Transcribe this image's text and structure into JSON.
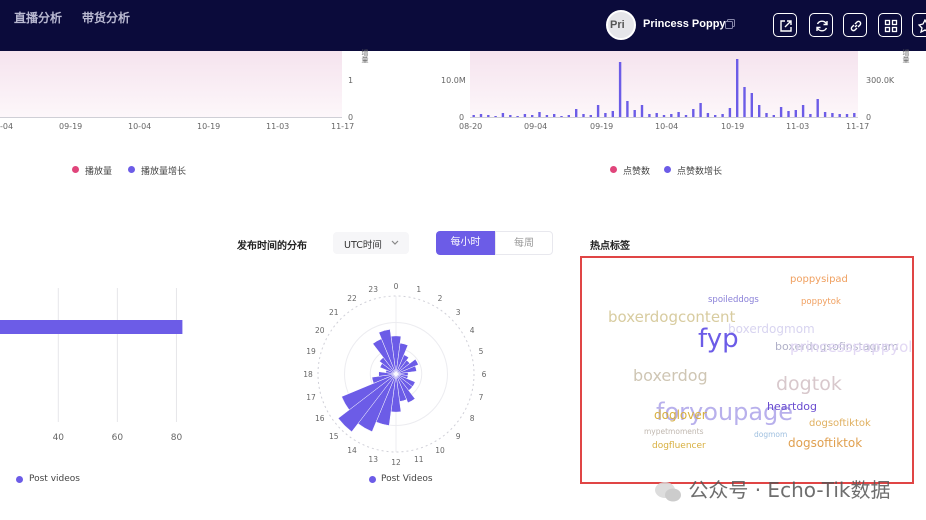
{
  "nav": {
    "tab_live": "直播分析",
    "tab_goods": "带货分析"
  },
  "profile": {
    "avatar_text": "Pri",
    "name": "Princess Poppy"
  },
  "toolbar": [
    "external-link-icon",
    "refresh-icon",
    "link-icon",
    "grid-icon",
    "pin-icon"
  ],
  "colors": {
    "accent": "#6c5ce7",
    "pink": "#e0457b",
    "nav_bg": "#0b0b3b",
    "highlight_border": "#e04545"
  },
  "charts_top": [
    {
      "type": "bar",
      "x_ticks": [
        "-04",
        "09-19",
        "10-04",
        "10-19",
        "11-03",
        "11-17"
      ],
      "right_axis_ticks": [
        "1",
        "0"
      ],
      "axis_title": "增量",
      "legend": [
        "播放量",
        "播放量增长"
      ]
    },
    {
      "type": "bar",
      "x_ticks": [
        "08-20",
        "09-04",
        "09-19",
        "10-04",
        "10-19",
        "11-03",
        "11-17"
      ],
      "left_axis_ticks": [
        "10.0M",
        "0"
      ],
      "right_axis_ticks": [
        "300.0K",
        "0"
      ],
      "axis_title": "增量",
      "legend": [
        "点赞数",
        "点赞数增长"
      ],
      "bar_values": [
        2,
        3,
        2,
        1,
        4,
        2,
        1,
        3,
        2,
        5,
        2,
        3,
        1,
        2,
        8,
        3,
        2,
        12,
        4,
        6,
        55,
        16,
        7,
        12,
        3,
        4,
        2,
        3,
        5,
        2,
        8,
        14,
        4,
        2,
        3,
        9,
        58,
        30,
        24,
        12,
        4,
        2,
        10,
        6,
        7,
        12,
        3,
        18,
        5,
        4,
        3,
        3,
        4
      ]
    }
  ],
  "publish_section": {
    "title": "发布时间的分布",
    "timezone": "UTC时间",
    "toggle": [
      "每小时",
      "每周"
    ],
    "active": 0
  },
  "chart_data": [
    {
      "type": "bar",
      "orientation": "horizontal",
      "x_ticks": [
        "40",
        "60",
        "80"
      ],
      "series": [
        {
          "name": "Post videos",
          "values": [
            82
          ]
        }
      ],
      "xlim": [
        25,
        90
      ]
    },
    {
      "type": "bar",
      "polar": true,
      "categories": [
        "0",
        "1",
        "2",
        "3",
        "4",
        "5",
        "6",
        "7",
        "8",
        "9",
        "10",
        "11",
        "12",
        "13",
        "14",
        "15",
        "16",
        "17",
        "18",
        "19",
        "20",
        "21",
        "22",
        "23"
      ],
      "series": [
        {
          "name": "Post Videos",
          "values": [
            22,
            18,
            12,
            10,
            14,
            12,
            7,
            7,
            12,
            12,
            18,
            16,
            22,
            30,
            36,
            42,
            34,
            14,
            10,
            6,
            10,
            12,
            22,
            26
          ]
        }
      ]
    }
  ],
  "hot_tags": {
    "title": "热点标签",
    "words": [
      "poppysipad",
      "spoileddogs",
      "poppytok",
      "boxerdogcontent",
      "boxerdogmom",
      "fyp",
      "boxerdogsofinstagram",
      "princesspoppyol",
      "boxerdog",
      "dogtok",
      "foryoupage",
      "heartdog",
      "dogsoftiktok",
      "doglover",
      "dogsoftiktok",
      "mypetmoments",
      "dogmom",
      "dogfluencer"
    ]
  },
  "watermark": "公众号 · Echo-Tik数据"
}
